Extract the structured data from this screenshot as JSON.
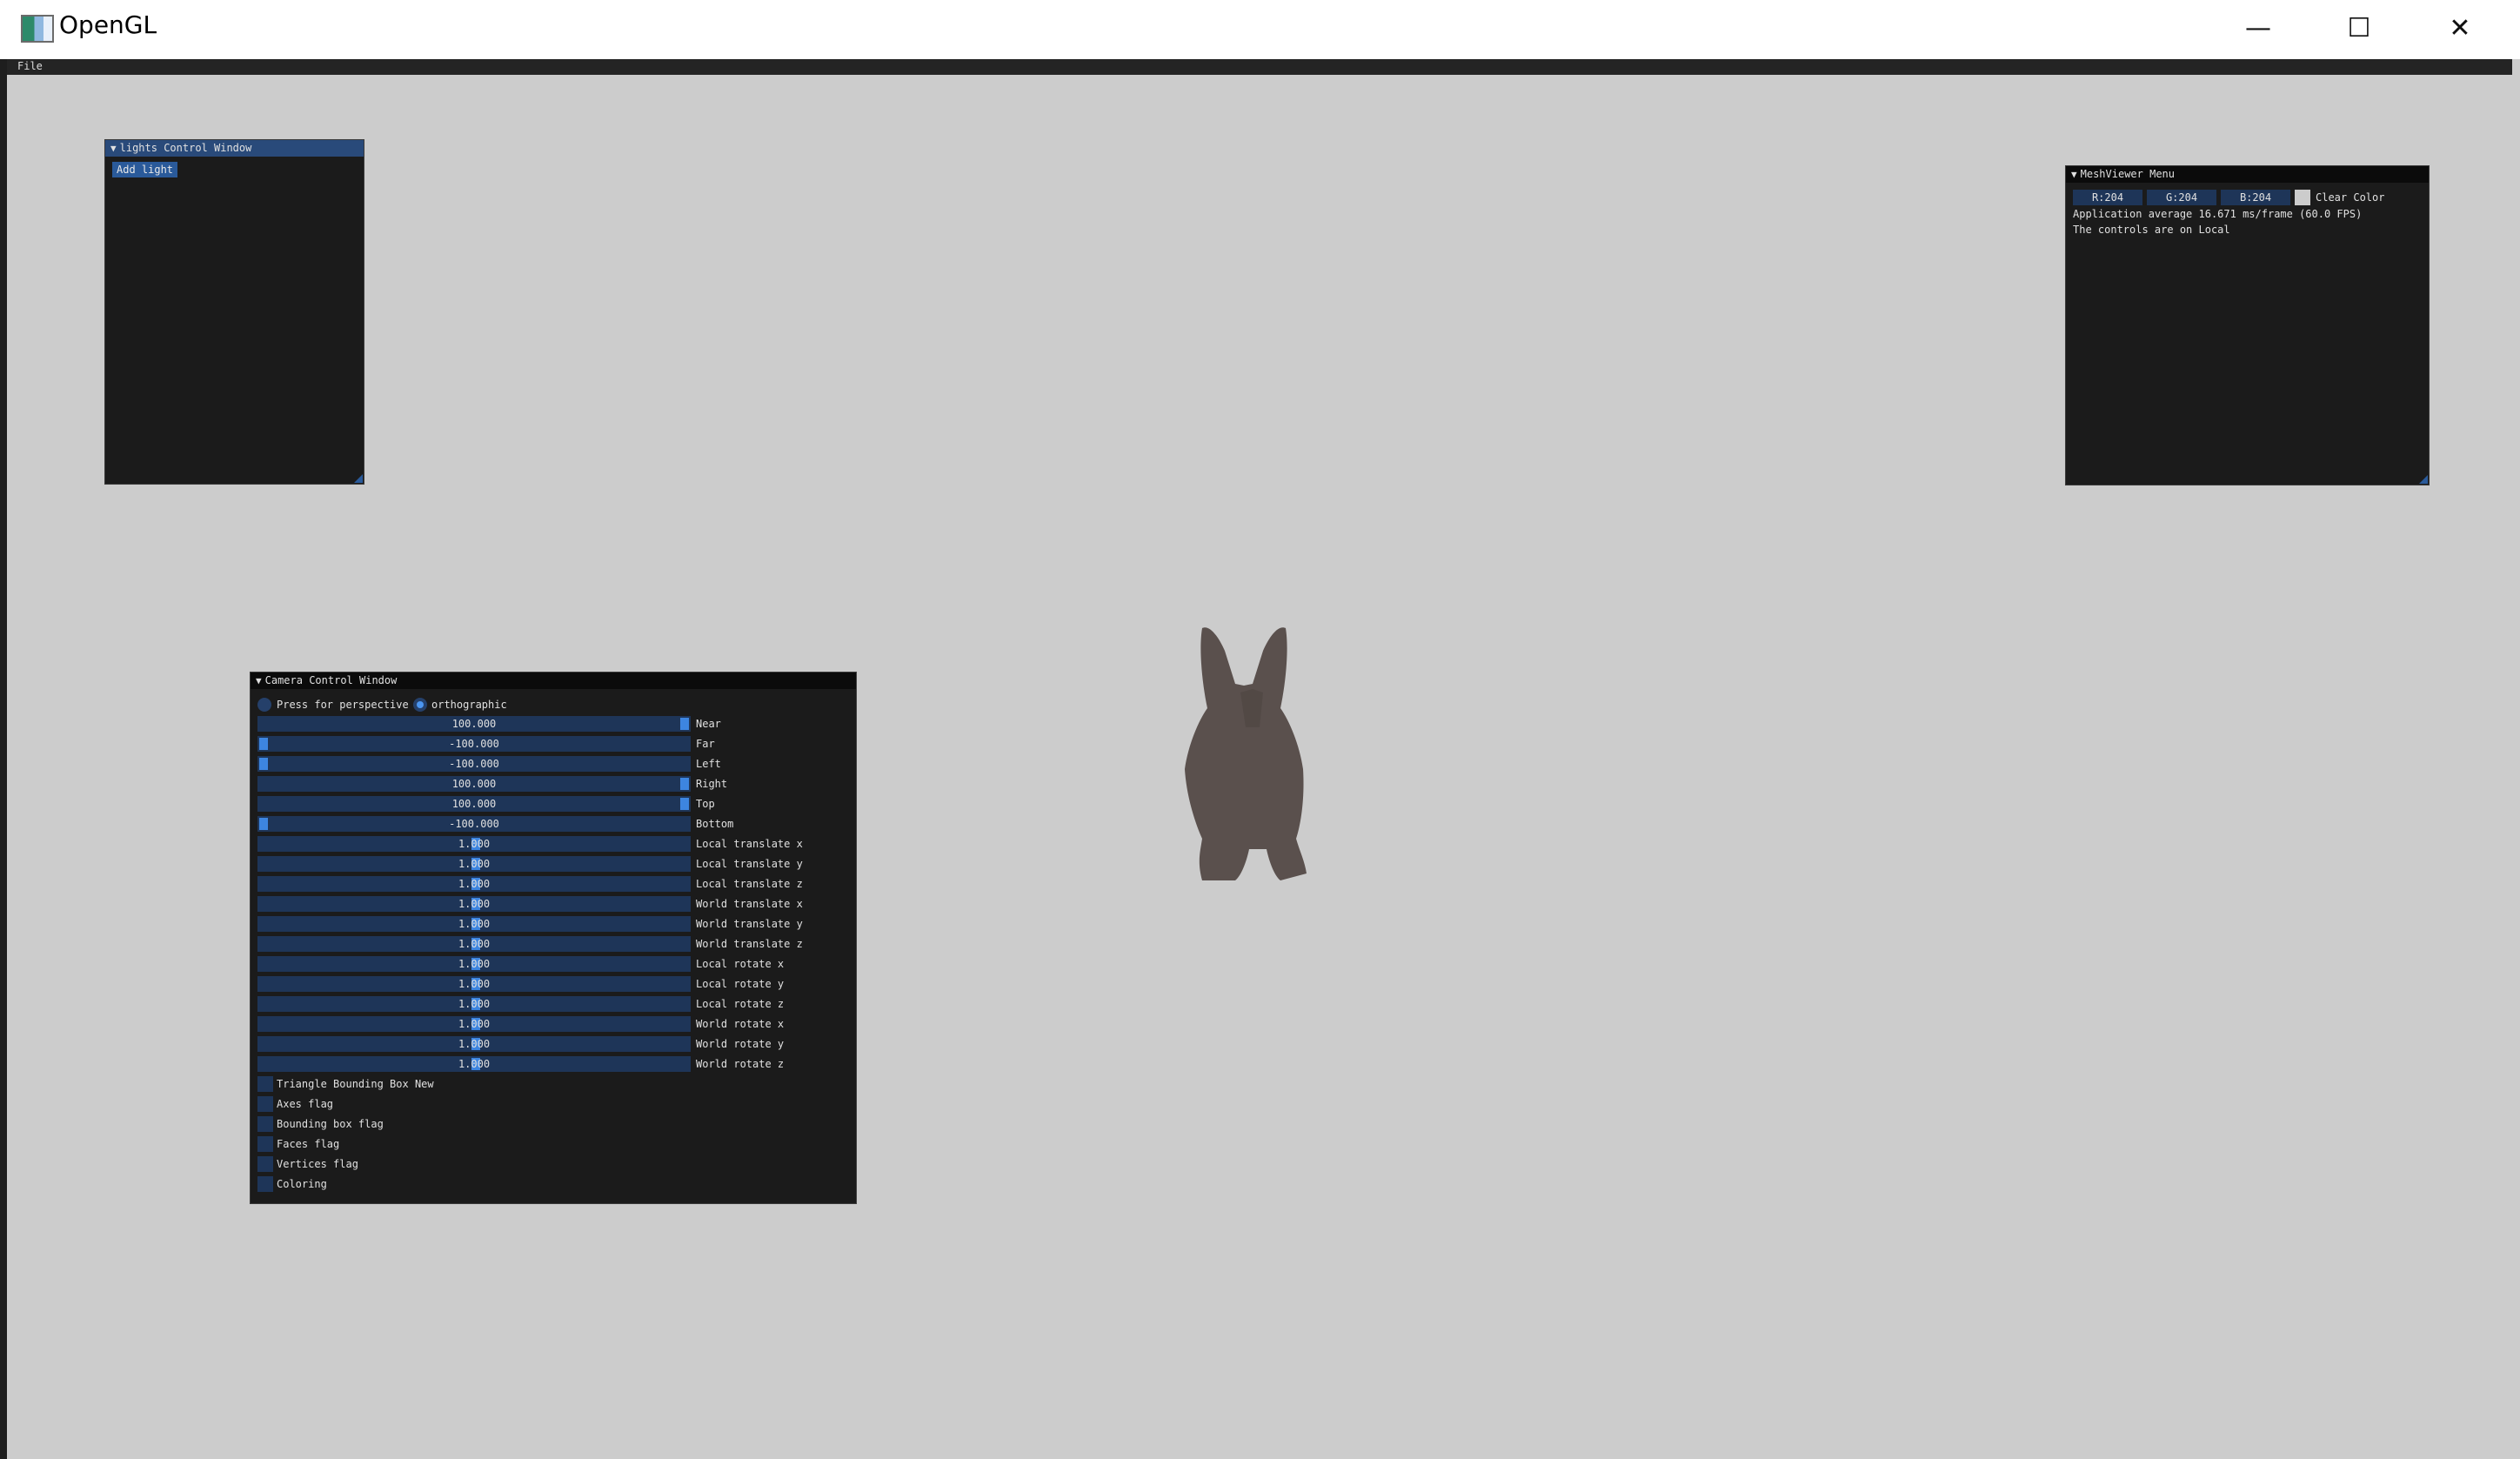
{
  "window": {
    "title": "OpenGL",
    "minimize_glyph": "—",
    "maximize_glyph": "☐",
    "close_glyph": "✕"
  },
  "menubar": {
    "file": "File"
  },
  "lights_window": {
    "title": "lights Control Window",
    "add_light": "Add light"
  },
  "meshviewer_window": {
    "title": "MeshViewer Menu",
    "r": "R:204",
    "g": "G:204",
    "b": "B:204",
    "clear_color_label": "Clear Color",
    "clear_color_hex": "#cccccc",
    "fps_text": "Application average 16.671 ms/frame (60.0 FPS)",
    "controls_text": "The controls are on Local"
  },
  "camera_window": {
    "title": "Camera Control Window",
    "perspective_label": "Press for perspective",
    "orthographic_label": "orthographic",
    "sliders": [
      {
        "label": "Near",
        "value": "100.000",
        "fraction": 1.0
      },
      {
        "label": "Far",
        "value": "-100.000",
        "fraction": 0.0
      },
      {
        "label": "Left",
        "value": "-100.000",
        "fraction": 0.0
      },
      {
        "label": "Right",
        "value": "100.000",
        "fraction": 1.0
      },
      {
        "label": "Top",
        "value": "100.000",
        "fraction": 1.0
      },
      {
        "label": "Bottom",
        "value": "-100.000",
        "fraction": 0.0
      },
      {
        "label": "Local translate x",
        "value": "1.000",
        "fraction": 0.505
      },
      {
        "label": "Local translate y",
        "value": "1.000",
        "fraction": 0.505
      },
      {
        "label": "Local translate z",
        "value": "1.000",
        "fraction": 0.505
      },
      {
        "label": "World translate x",
        "value": "1.000",
        "fraction": 0.505
      },
      {
        "label": "World translate y",
        "value": "1.000",
        "fraction": 0.505
      },
      {
        "label": "World translate z",
        "value": "1.000",
        "fraction": 0.505
      },
      {
        "label": "Local rotate x",
        "value": "1.000",
        "fraction": 0.505
      },
      {
        "label": "Local rotate y",
        "value": "1.000",
        "fraction": 0.505
      },
      {
        "label": "Local rotate z",
        "value": "1.000",
        "fraction": 0.505
      },
      {
        "label": "World rotate x",
        "value": "1.000",
        "fraction": 0.505
      },
      {
        "label": "World rotate y",
        "value": "1.000",
        "fraction": 0.505
      },
      {
        "label": "World rotate z",
        "value": "1.000",
        "fraction": 0.505
      }
    ],
    "checkboxes": [
      "Triangle Bounding Box New",
      "Axes flag",
      "Bounding box flag",
      "Faces flag",
      "Vertices flag",
      "Coloring"
    ]
  },
  "model": {
    "icon": "bunny-silhouette",
    "color": "#5a504d"
  }
}
